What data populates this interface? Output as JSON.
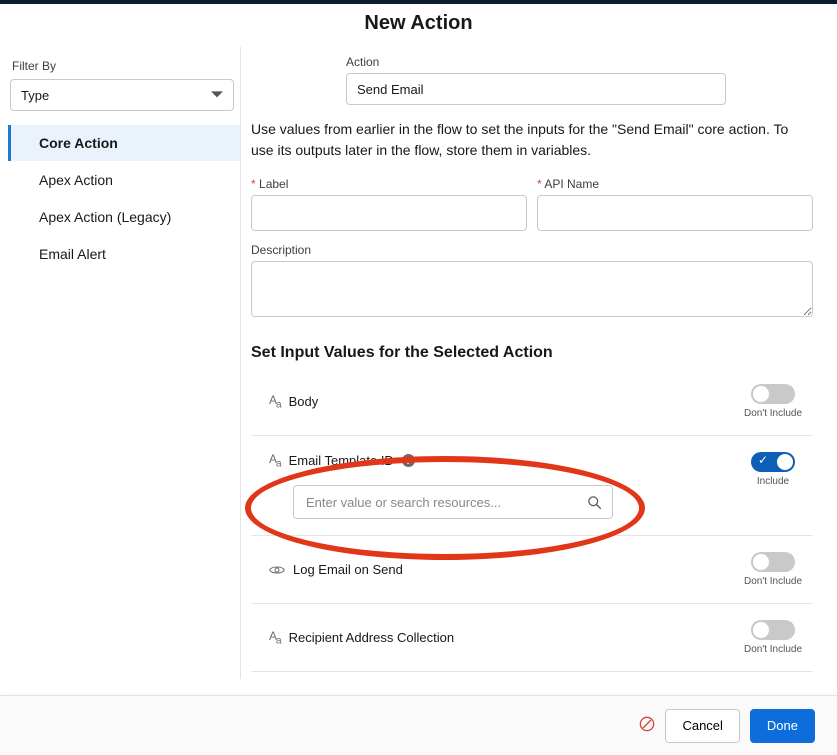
{
  "title": "New Action",
  "sidebar": {
    "filter_label": "Filter By",
    "type_value": "Type",
    "items": [
      {
        "label": "Core Action"
      },
      {
        "label": "Apex Action"
      },
      {
        "label": "Apex Action (Legacy)"
      },
      {
        "label": "Email Alert"
      }
    ]
  },
  "action": {
    "field_label": "Action",
    "value": "Send Email"
  },
  "helptext": "Use values from earlier in the flow to set the inputs for the \"Send Email\" core action. To use its outputs later in the flow, store them in variables.",
  "labels": {
    "label": "Label",
    "apiname": "API Name",
    "description": "Description"
  },
  "values": {
    "label": "",
    "apiname": "",
    "description": ""
  },
  "section_heading": "Set Input Values for the Selected Action",
  "toggle_labels": {
    "include": "Include",
    "dont_include": "Don't Include"
  },
  "rows": [
    {
      "type": "text",
      "label": "Body"
    },
    {
      "type": "text",
      "label": "Email Template ID",
      "placeholder": "Enter value or search resources..."
    },
    {
      "type": "bool",
      "label": "Log Email on Send"
    },
    {
      "type": "text",
      "label": "Recipient Address Collection"
    }
  ],
  "footer": {
    "cancel": "Cancel",
    "done": "Done"
  }
}
